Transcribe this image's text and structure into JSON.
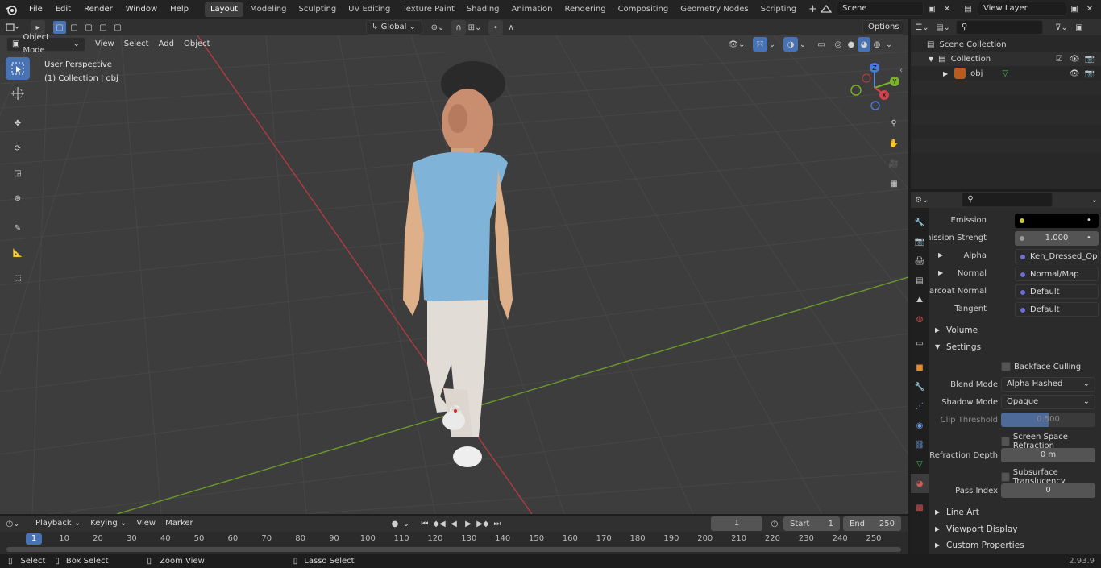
{
  "topbar": {
    "menus": [
      "File",
      "Edit",
      "Render",
      "Window",
      "Help"
    ],
    "workspaces": [
      "Layout",
      "Modeling",
      "Sculpting",
      "UV Editing",
      "Texture Paint",
      "Shading",
      "Animation",
      "Rendering",
      "Compositing",
      "Geometry Nodes",
      "Scripting"
    ],
    "active_workspace": "Layout",
    "scene": "Scene",
    "view_layer": "View Layer"
  },
  "viewport_header": {
    "mode": "Object Mode",
    "menus": [
      "View",
      "Select",
      "Add",
      "Object"
    ],
    "transform_orientation": "Global",
    "options_label": "Options"
  },
  "viewport": {
    "perspective_label": "User Perspective",
    "collection_label": "(1) Collection | obj",
    "axis_labels": {
      "z": "Z",
      "y": "Y",
      "x": "X"
    }
  },
  "outliner": {
    "scene_collection": "Scene Collection",
    "collection": "Collection",
    "object": "obj"
  },
  "properties": {
    "rows": [
      {
        "label": "Emission",
        "value": "",
        "dot": "#c9c93b",
        "style": "black"
      },
      {
        "label": "Emission Strengt",
        "value": "1.000",
        "dot": "#9a9a9a",
        "style": "number"
      },
      {
        "label": "Alpha",
        "value": "Ken_Dressed_Opacit...",
        "dot": "#6d6dd6",
        "style": "link"
      },
      {
        "label": "Normal",
        "value": "Normal/Map",
        "dot": "#6d6dd6",
        "style": "link"
      },
      {
        "label": "Clearcoat Normal",
        "value": "Default",
        "dot": "#6d6dd6",
        "style": "link"
      },
      {
        "label": "Tangent",
        "value": "Default",
        "dot": "#6d6dd6",
        "style": "link"
      }
    ],
    "panels": {
      "volume": "Volume",
      "settings": "Settings",
      "line_art": "Line Art",
      "viewport_display": "Viewport Display",
      "custom_properties": "Custom Properties"
    },
    "settings": {
      "backface_culling": "Backface Culling",
      "blend_mode_label": "Blend Mode",
      "blend_mode": "Alpha Hashed",
      "shadow_mode_label": "Shadow Mode",
      "shadow_mode": "Opaque",
      "clip_threshold_label": "Clip Threshold",
      "clip_threshold": "0.500",
      "screen_space_refraction": "Screen Space Refraction",
      "refraction_depth_label": "Refraction Depth",
      "refraction_depth": "0 m",
      "subsurface_translucency": "Subsurface Translucency",
      "pass_index_label": "Pass Index",
      "pass_index": "0"
    }
  },
  "timeline": {
    "menus": [
      "Playback",
      "Keying",
      "View",
      "Marker"
    ],
    "current_frame": "1",
    "start_label": "Start",
    "start": "1",
    "end_label": "End",
    "end": "250",
    "ruler": [
      "1",
      "10",
      "20",
      "30",
      "40",
      "50",
      "60",
      "70",
      "80",
      "90",
      "100",
      "110",
      "120",
      "130",
      "140",
      "150",
      "160",
      "170",
      "180",
      "190",
      "200",
      "210",
      "220",
      "230",
      "240",
      "250"
    ]
  },
  "statusbar": {
    "select": "Select",
    "box_select": "Box Select",
    "zoom_view": "Zoom View",
    "lasso_select": "Lasso Select",
    "version": "2.93.9"
  }
}
